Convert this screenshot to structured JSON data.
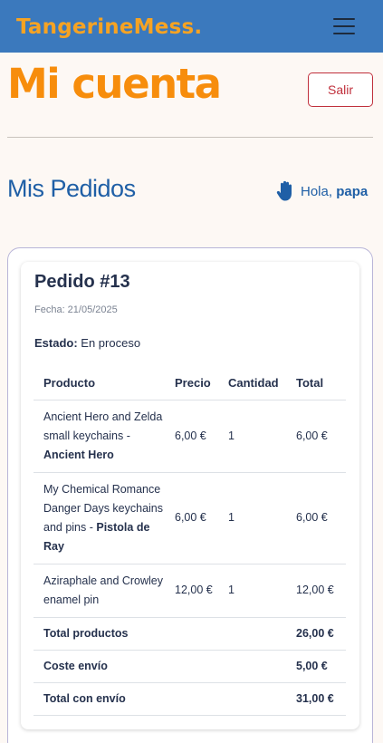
{
  "header": {
    "brand": "TangerineMess.",
    "menu_icon": "hamburger-menu-icon"
  },
  "account": {
    "title": "Mi cuenta",
    "logout_label": "Salir"
  },
  "orders": {
    "section_title": "Mis Pedidos",
    "greeting_prefix": "Hola,",
    "user_name": "papa",
    "greeting_icon": "hand-icon"
  },
  "order": {
    "title": "Pedido #13",
    "date": "Fecha: 21/05/2025",
    "status_label": "Estado:",
    "status_value": "En proceso",
    "columns": [
      "Producto",
      "Precio",
      "Cantidad",
      "Total"
    ],
    "items": [
      {
        "name": "Ancient Hero and Zelda small keychains - ",
        "variant": "Ancient Hero",
        "price": "6,00 €",
        "qty": "1",
        "total": "6,00 €"
      },
      {
        "name": "My Chemical Romance Danger Days keychains and pins - ",
        "variant": "Pistola de Ray",
        "price": "6,00 €",
        "qty": "1",
        "total": "6,00 €"
      },
      {
        "name": "Aziraphale and Crowley enamel pin",
        "variant": "",
        "price": "12,00 €",
        "qty": "1",
        "total": "12,00 €"
      }
    ],
    "totals": [
      {
        "label": "Total productos",
        "value": "26,00 €"
      },
      {
        "label": "Coste envío",
        "value": "5,00 €"
      },
      {
        "label": "Total con envío",
        "value": "31,00 €"
      }
    ]
  },
  "colors": {
    "navbar": "#3b79bd",
    "brand": "#f6a323",
    "title": "#f78d0c",
    "link_blue": "#1f5fa6",
    "danger": "#c0303c"
  }
}
